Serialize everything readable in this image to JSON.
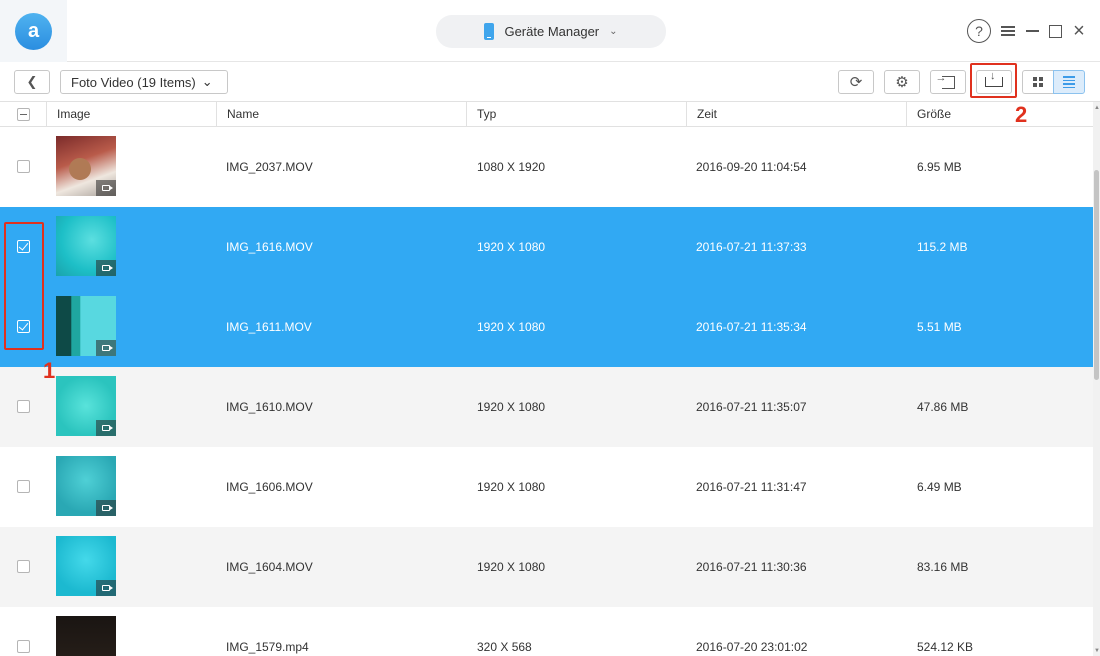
{
  "app": {
    "logo_letter": "a",
    "device_name": "Geräte Manager",
    "help_glyph": "?",
    "close_glyph": "×"
  },
  "toolbar": {
    "back_glyph": "❮",
    "album_label": "Foto Video (19 Items)",
    "album_chevron": "⌄",
    "refresh_glyph": "⟳",
    "settings_glyph": "⚙"
  },
  "columns": {
    "image": "Image",
    "name": "Name",
    "typ": "Typ",
    "zeit": "Zeit",
    "size": "Größe"
  },
  "rows": [
    {
      "name": "IMG_2037.MOV",
      "typ": "1080 X 1920",
      "zeit": "2016-09-20 11:04:54",
      "size": "6.95 MB",
      "checked": false
    },
    {
      "name": "IMG_1616.MOV",
      "typ": "1920 X 1080",
      "zeit": "2016-07-21 11:37:33",
      "size": "115.2 MB",
      "checked": true
    },
    {
      "name": "IMG_1611.MOV",
      "typ": "1920 X 1080",
      "zeit": "2016-07-21 11:35:34",
      "size": "5.51 MB",
      "checked": true
    },
    {
      "name": "IMG_1610.MOV",
      "typ": "1920 X 1080",
      "zeit": "2016-07-21 11:35:07",
      "size": "47.86 MB",
      "checked": false
    },
    {
      "name": "IMG_1606.MOV",
      "typ": "1920 X 1080",
      "zeit": "2016-07-21 11:31:47",
      "size": "6.49 MB",
      "checked": false
    },
    {
      "name": "IMG_1604.MOV",
      "typ": "1920 X 1080",
      "zeit": "2016-07-21 11:30:36",
      "size": "83.16 MB",
      "checked": false
    },
    {
      "name": "IMG_1579.mp4",
      "typ": "320 X 568",
      "zeit": "2016-07-20 23:01:02",
      "size": "524.12 KB",
      "checked": false
    }
  ],
  "annotations": {
    "step1": "1",
    "step2": "2"
  },
  "colors": {
    "selection": "#31a9f3",
    "accent": "#3c9be8",
    "annotation": "#e0311e"
  }
}
